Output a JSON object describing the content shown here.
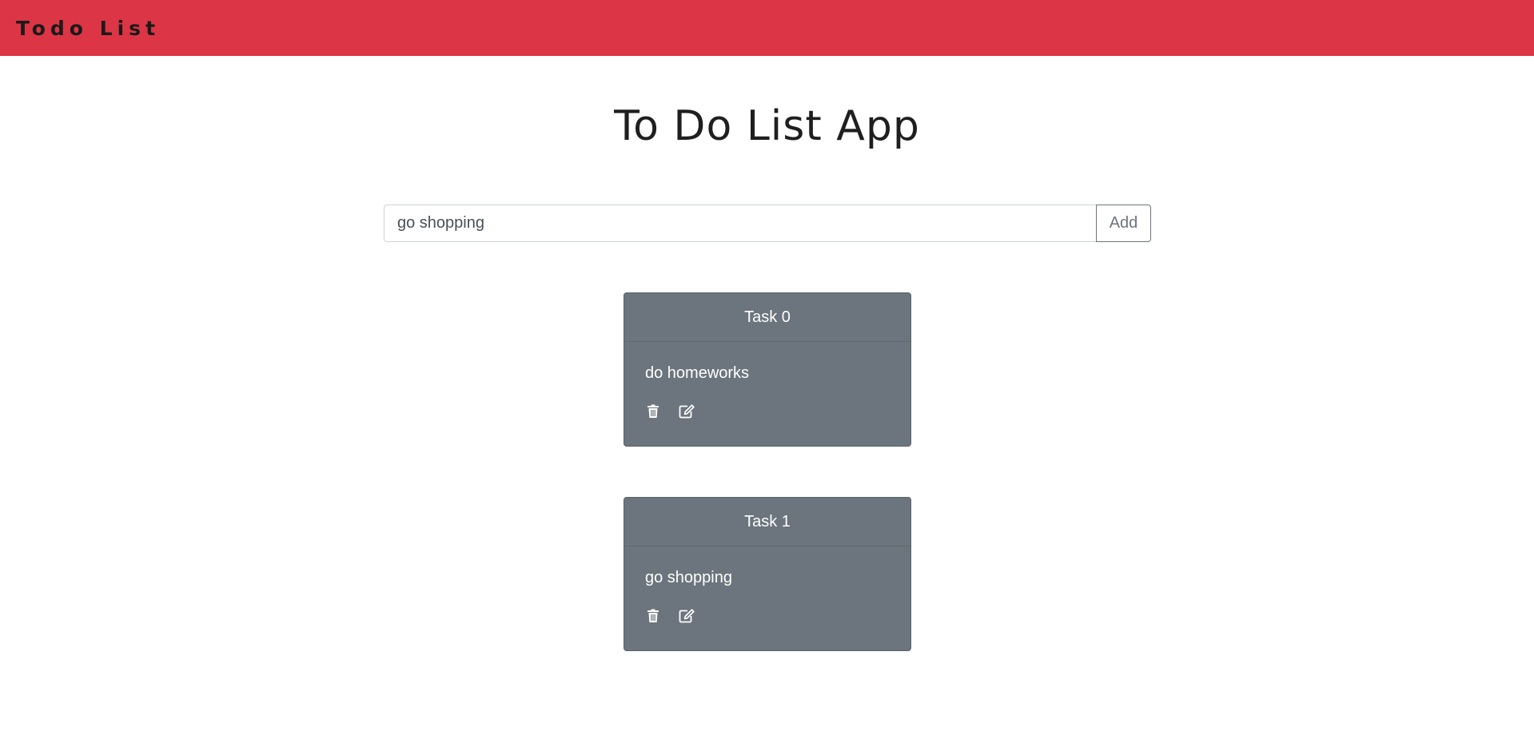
{
  "navbar": {
    "brand": "Todo List",
    "background_color": "#dc3545"
  },
  "page": {
    "title": "To Do List App"
  },
  "add_form": {
    "input_value": "go shopping",
    "add_label": "Add"
  },
  "tasks": [
    {
      "header": "Task 0",
      "text": "do homeworks",
      "delete_icon": "trash-icon",
      "edit_icon": "edit-icon"
    },
    {
      "header": "Task 1",
      "text": "go shopping",
      "delete_icon": "trash-icon",
      "edit_icon": "edit-icon"
    }
  ],
  "colors": {
    "card_background": "#6c757d",
    "card_text": "#ffffff"
  }
}
